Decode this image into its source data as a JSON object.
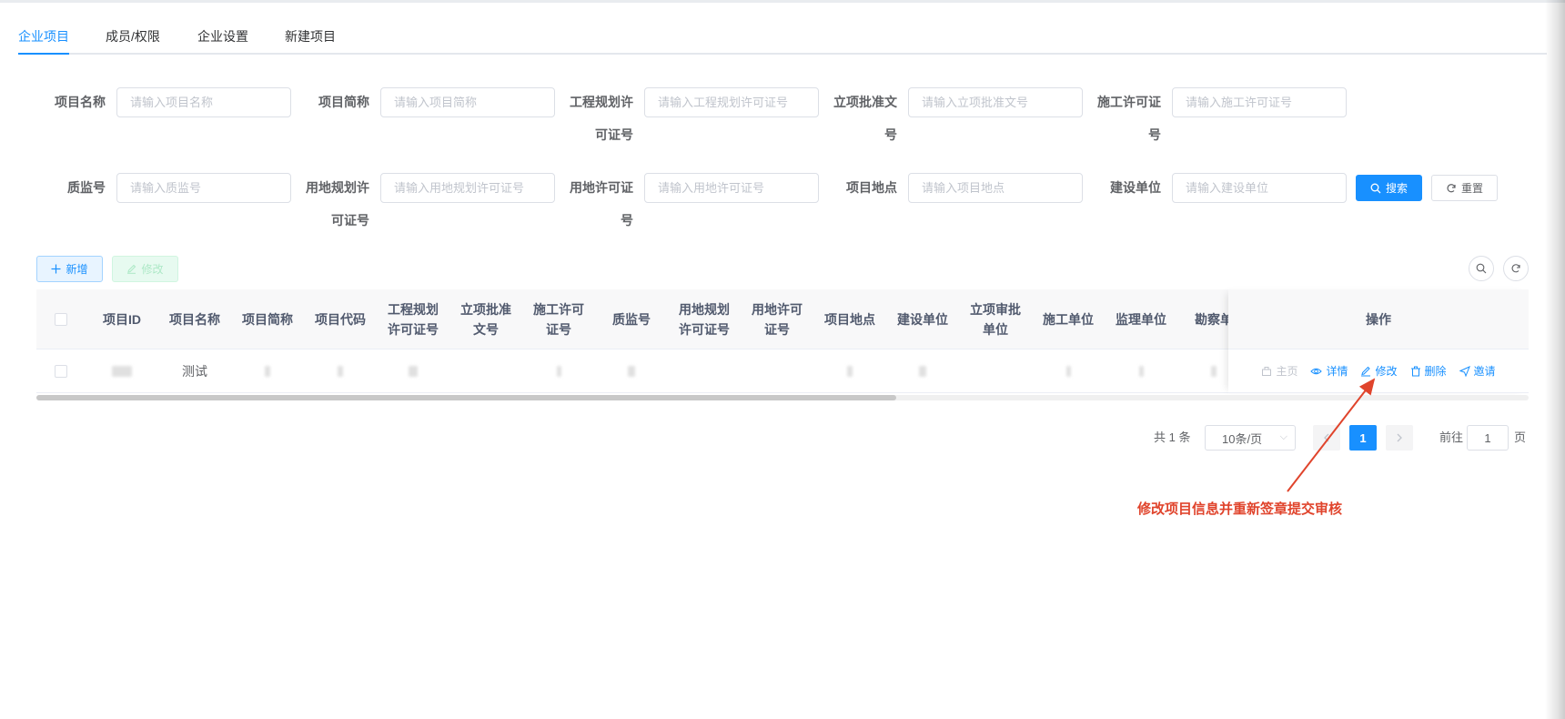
{
  "tabs": [
    {
      "label": "企业项目",
      "active": true
    },
    {
      "label": "成员/权限",
      "active": false
    },
    {
      "label": "企业设置",
      "active": false
    },
    {
      "label": "新建项目",
      "active": false
    }
  ],
  "search": {
    "fields": [
      {
        "label": "项目名称",
        "placeholder": "请输入项目名称"
      },
      {
        "label": "项目简称",
        "placeholder": "请输入项目简称"
      },
      {
        "label_line1": "工程规划许",
        "label_line2": "可证号",
        "placeholder": "请输入工程规划许可证号"
      },
      {
        "label_line1": "立项批准文",
        "label_line2": "号",
        "placeholder": "请输入立项批准文号"
      },
      {
        "label_line1": "施工许可证",
        "label_line2": "号",
        "placeholder": "请输入施工许可证号"
      },
      {
        "label": "质监号",
        "placeholder": "请输入质监号"
      },
      {
        "label_line1": "用地规划许",
        "label_line2": "可证号",
        "placeholder": "请输入用地规划许可证号"
      },
      {
        "label_line1": "用地许可证",
        "label_line2": "号",
        "placeholder": "请输入用地许可证号"
      },
      {
        "label": "项目地点",
        "placeholder": "请输入项目地点"
      },
      {
        "label": "建设单位",
        "placeholder": "请输入建设单位"
      }
    ],
    "search_label": "搜索",
    "reset_label": "重置"
  },
  "toolbar": {
    "add_label": "新增",
    "edit_label": "修改"
  },
  "table": {
    "columns": [
      {
        "line1": "项目ID",
        "line2": ""
      },
      {
        "line1": "项目名称",
        "line2": ""
      },
      {
        "line1": "项目简称",
        "line2": ""
      },
      {
        "line1": "项目代码",
        "line2": ""
      },
      {
        "line1": "工程规划",
        "line2": "许可证号"
      },
      {
        "line1": "立项批准",
        "line2": "文号"
      },
      {
        "line1": "施工许可",
        "line2": "证号"
      },
      {
        "line1": "质监号",
        "line2": ""
      },
      {
        "line1": "用地规划",
        "line2": "许可证号"
      },
      {
        "line1": "用地许可",
        "line2": "证号"
      },
      {
        "line1": "项目地点",
        "line2": ""
      },
      {
        "line1": "建设单位",
        "line2": ""
      },
      {
        "line1": "立项审批",
        "line2": "单位"
      },
      {
        "line1": "施工单位",
        "line2": ""
      },
      {
        "line1": "监理单位",
        "line2": ""
      },
      {
        "line1": "勘察单",
        "line2": ""
      }
    ],
    "ops_header": "操作",
    "rows": [
      {
        "project_name": "测试"
      }
    ],
    "ops": {
      "home": "主页",
      "detail": "详情",
      "edit": "修改",
      "delete": "删除",
      "invite": "邀请"
    }
  },
  "pagination": {
    "total_text": "共 1 条",
    "page_size": "10条/页",
    "current_page": "1",
    "goto_label": "前往",
    "goto_value": "1",
    "page_suffix": "页"
  },
  "annotation": "修改项目信息并重新签章提交审核",
  "colors": {
    "primary": "#1890ff",
    "annotation": "#e0442c",
    "success_light": "#e7faf0"
  }
}
